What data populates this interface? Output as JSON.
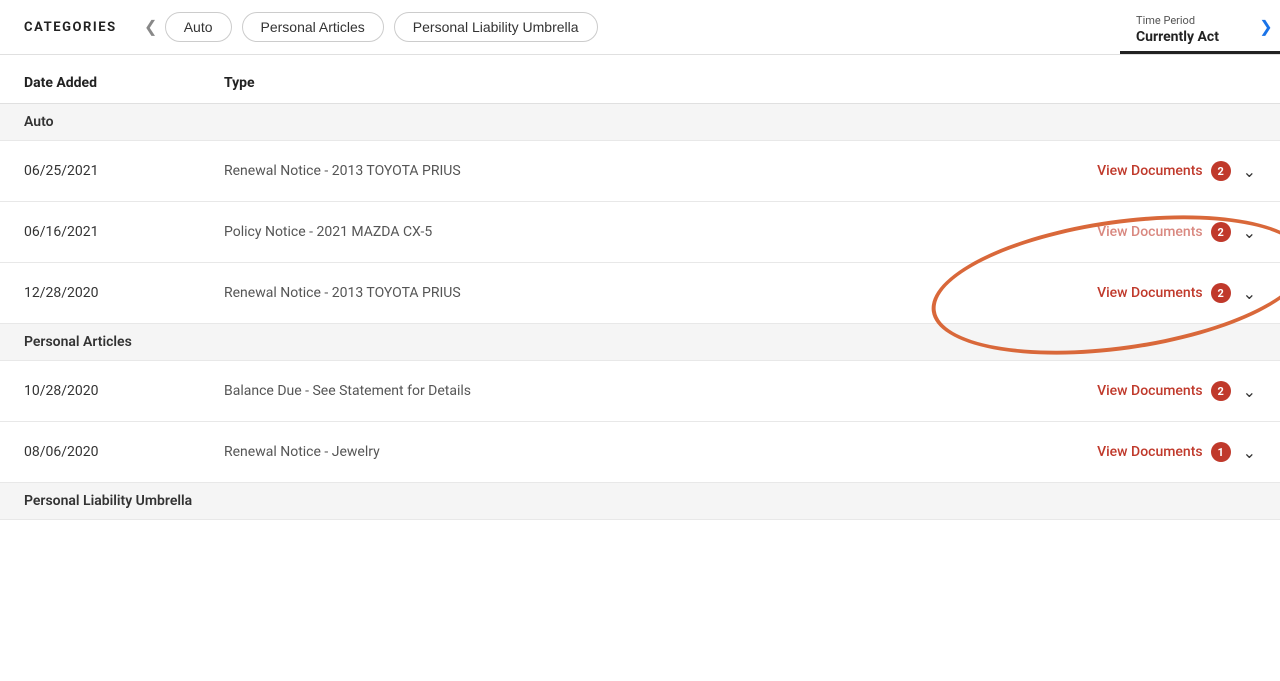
{
  "header": {
    "categories_label": "CATEGORIES",
    "prev_arrow": "‹",
    "next_arrow": "›",
    "tabs": [
      {
        "label": "Auto",
        "id": "auto"
      },
      {
        "label": "Personal Articles",
        "id": "personal-articles"
      },
      {
        "label": "Personal Liability Umbrella",
        "id": "personal-liability-umbrella"
      }
    ],
    "time_period": {
      "label": "Time Period",
      "value": "Currently Act"
    }
  },
  "table": {
    "col_date_header": "Date Added",
    "col_type_header": "Type",
    "view_docs_label": "View Documents",
    "groups": [
      {
        "group_name": "Auto",
        "rows": [
          {
            "date": "06/25/2021",
            "type": "Renewal Notice - 2013 TOYOTA PRIUS",
            "badge": "2"
          },
          {
            "date": "06/16/2021",
            "type": "Policy Notice - 2021 MAZDA CX-5",
            "badge": "2"
          },
          {
            "date": "12/28/2020",
            "type": "Renewal Notice - 2013 TOYOTA PRIUS",
            "badge": "2"
          }
        ]
      },
      {
        "group_name": "Personal Articles",
        "rows": [
          {
            "date": "10/28/2020",
            "type": "Balance Due - See Statement for Details",
            "badge": "2"
          },
          {
            "date": "08/06/2020",
            "type": "Renewal Notice - Jewelry",
            "badge": "1"
          }
        ]
      },
      {
        "group_name": "Personal Liability Umbrella",
        "rows": []
      }
    ]
  },
  "icons": {
    "chevron_left": "❮",
    "chevron_right": "❯",
    "chevron_down": "∨"
  }
}
